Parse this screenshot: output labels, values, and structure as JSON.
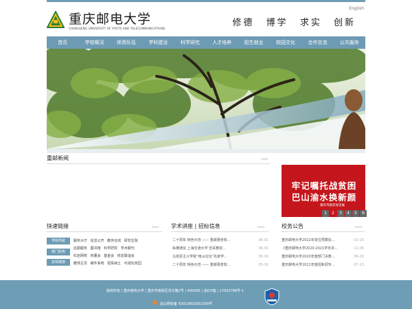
{
  "header": {
    "english_link": "English",
    "logo_cn": "重庆邮电大学",
    "logo_en": "CHONGQING UNIVERSITY OF POSTS AND TELECOMMUNICATIONS",
    "motto": [
      "修德",
      "博学",
      "求实",
      "创新"
    ]
  },
  "nav": [
    "首页",
    "学校概况",
    "师资队伍",
    "学科建设",
    "科学研究",
    "人才培养",
    "招生就业",
    "校园文化",
    "合作交流",
    "公共服务"
  ],
  "news": {
    "title": "重邮新闻",
    "more": "more",
    "image_line1": "牢记嘱托战贫困",
    "image_line2": "巴山渝水换新颜",
    "image_sub": "重庆市脱贫攻坚展",
    "pages": [
      "1",
      "2",
      "3",
      "4",
      "5",
      "6"
    ],
    "active_page": "2"
  },
  "quick_links": {
    "title": "快速链接",
    "more": "more",
    "badges": [
      "学院导航",
      "部门机构",
      "友情链接"
    ],
    "rows": [
      "服务大厅 信息公开 教务在线 研究生院",
      "后勤服务 图书馆 科学研究 学术期刊",
      "红岩网校 校董会 基金会 校友联谊会",
      "教师主页 邮件系统 招贤纳士 可视化校园"
    ]
  },
  "lectures": {
    "title": "学术讲座 | 招标信息",
    "more": "more",
    "items": [
      {
        "text": "二十周年·特色示范 —— 重邮惠普软...",
        "date": "06-01"
      },
      {
        "text": "纵横通信 上海交通大学 伍军教授...",
        "date": "06-01"
      },
      {
        "text": "马克思主义学院“南山论坛”名家学...",
        "date": "05-30"
      },
      {
        "text": "二十周年·特色示范 —— 重邮惠普软...",
        "date": "05-30"
      }
    ]
  },
  "notices": {
    "title": "校务公告",
    "more": "more",
    "items": [
      {
        "text": "重庆邮电大学2022年单位预算信...",
        "date": "02-25"
      },
      {
        "text": "《重庆邮电大学2020-2021学年本...",
        "date": "11-05"
      },
      {
        "text": "重庆邮电大学2020年度部门决算...",
        "date": "09-20"
      },
      {
        "text": "重庆邮电大学2021年度招新调专...",
        "date": "07-13"
      }
    ]
  },
  "footer": {
    "line1": "版权所有 | 重庆邮电大学 | 重庆市南岸区崇文路2号 | 400065 | 渝ICP备 | 17002788号-1",
    "line2": "渝公网安备 50010802001309号"
  },
  "colors": {
    "nav": "#6d9bb3",
    "footer": "#6e9db6",
    "accent_red": "#c4161c"
  }
}
